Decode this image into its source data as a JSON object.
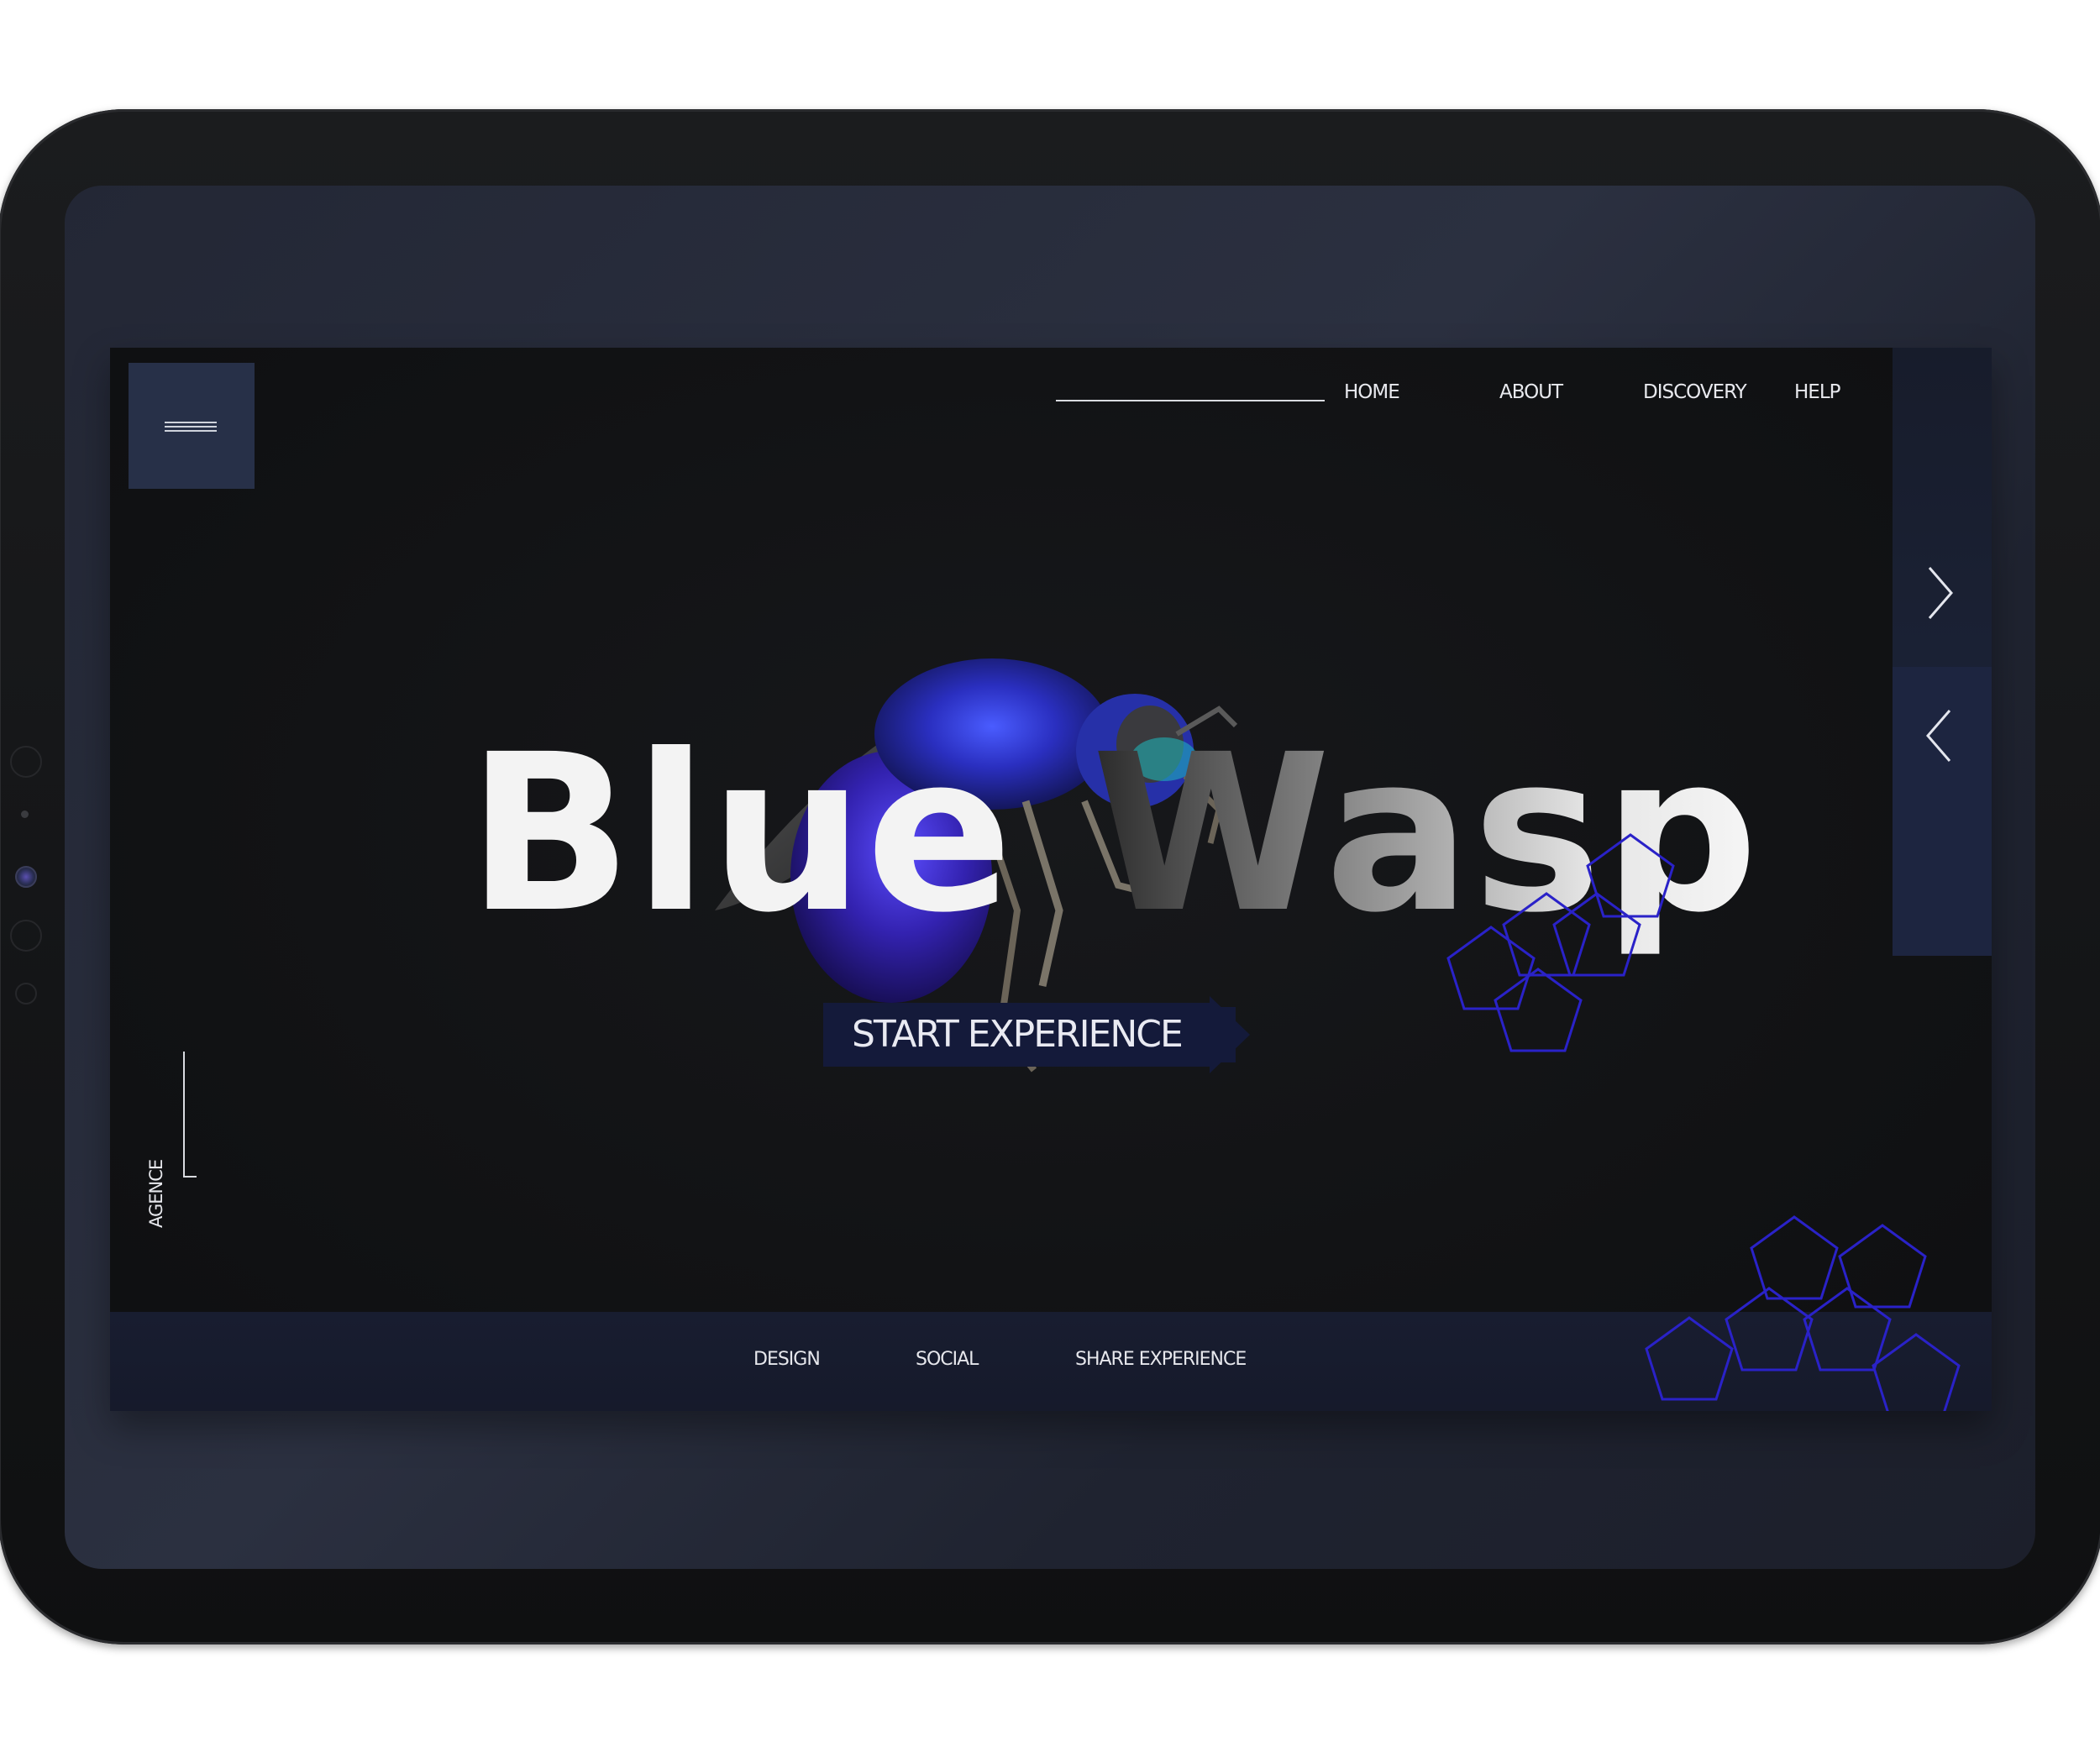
{
  "nav": {
    "items": [
      "HOME",
      "ABOUT",
      "DISCOVERY",
      "HELP"
    ]
  },
  "hero": {
    "title_word1": "Blue",
    "title_word2": "Wasp",
    "cta_label": "START EXPERIENCE"
  },
  "side": {
    "label": "AGENCE",
    "next_icon": "chevron-right-icon",
    "prev_icon": "chevron-left-icon"
  },
  "footer": {
    "items": [
      "DESIGN",
      "SOCIAL",
      "SHARE EXPERIENCE"
    ]
  },
  "colors": {
    "accent_blue": "#2a22c8",
    "panel_navy": "#273048",
    "background": "#121315"
  }
}
